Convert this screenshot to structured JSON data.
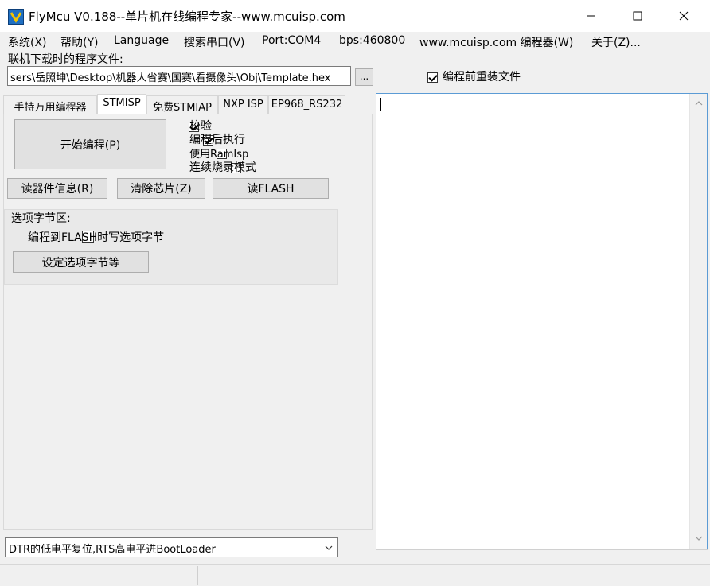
{
  "window": {
    "title": "FlyMcu V0.188--单片机在线编程专家--www.mcuisp.com"
  },
  "menu": {
    "items": [
      "系统(X)",
      "帮助(Y)",
      "Language",
      "搜索串口(V)",
      "Port:COM4",
      "bps:460800",
      "www.mcuisp.com 编程器(W)",
      "关于(Z)..."
    ]
  },
  "file": {
    "label": "联机下载时的程序文件:",
    "path": "sers\\岳照坤\\Desktop\\机器人省赛\\国赛\\看摄像头\\Obj\\Template.hex",
    "browse_label": "...",
    "reload_label": "编程前重装文件",
    "reload_checked": true
  },
  "tabs": [
    "手持万用编程器",
    "STMISP",
    "免费STMIAP",
    "NXP ISP",
    "EP968_RS232"
  ],
  "stmisp": {
    "start_button": "开始编程(P)",
    "options": [
      {
        "label": "校验",
        "checked": true
      },
      {
        "label": "编程后执行",
        "checked": true
      },
      {
        "label": "使用RamIsp",
        "checked": false
      },
      {
        "label": "连续烧录模式",
        "checked": false
      }
    ],
    "read_info_button": "读器件信息(R)",
    "erase_button": "清除芯片(Z)",
    "read_flash_button": "读FLASH",
    "option_bytes": {
      "title": "选项字节区:",
      "write_on_program_label": "编程到FLASH时写选项字节",
      "write_on_program_checked": false,
      "set_button": "设定选项字节等"
    }
  },
  "dtr_mode": {
    "selected": "DTR的低电平复位,RTS高电平进BootLoader"
  },
  "log": {
    "content": ""
  }
}
